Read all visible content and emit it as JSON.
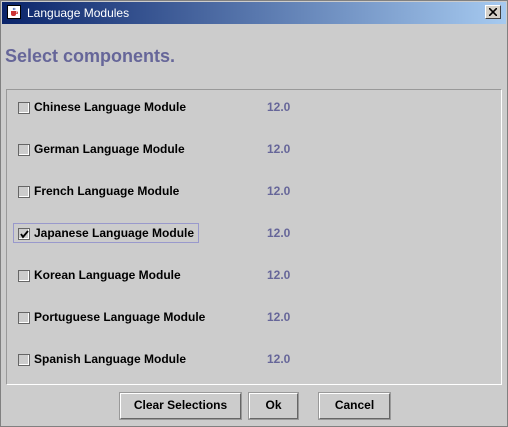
{
  "window": {
    "title": "Language Modules",
    "close_label": "×"
  },
  "heading": "Select components.",
  "modules": [
    {
      "label": "Chinese Language Module",
      "version": "12.0",
      "checked": false
    },
    {
      "label": "German Language Module",
      "version": "12.0",
      "checked": false
    },
    {
      "label": "French Language Module",
      "version": "12.0",
      "checked": false
    },
    {
      "label": "Japanese Language Module",
      "version": "12.0",
      "checked": true,
      "focused": true
    },
    {
      "label": "Korean Language Module",
      "version": "12.0",
      "checked": false
    },
    {
      "label": "Portuguese Language Module",
      "version": "12.0",
      "checked": false
    },
    {
      "label": "Spanish Language Module",
      "version": "12.0",
      "checked": false
    }
  ],
  "buttons": {
    "clear_label": "Clear Selections",
    "ok_label": "Ok",
    "cancel_label": "Cancel"
  },
  "colors": {
    "accent": "#666699",
    "titlebar_start": "#0a246a",
    "titlebar_end": "#a6caf0",
    "background": "#cccccc"
  }
}
